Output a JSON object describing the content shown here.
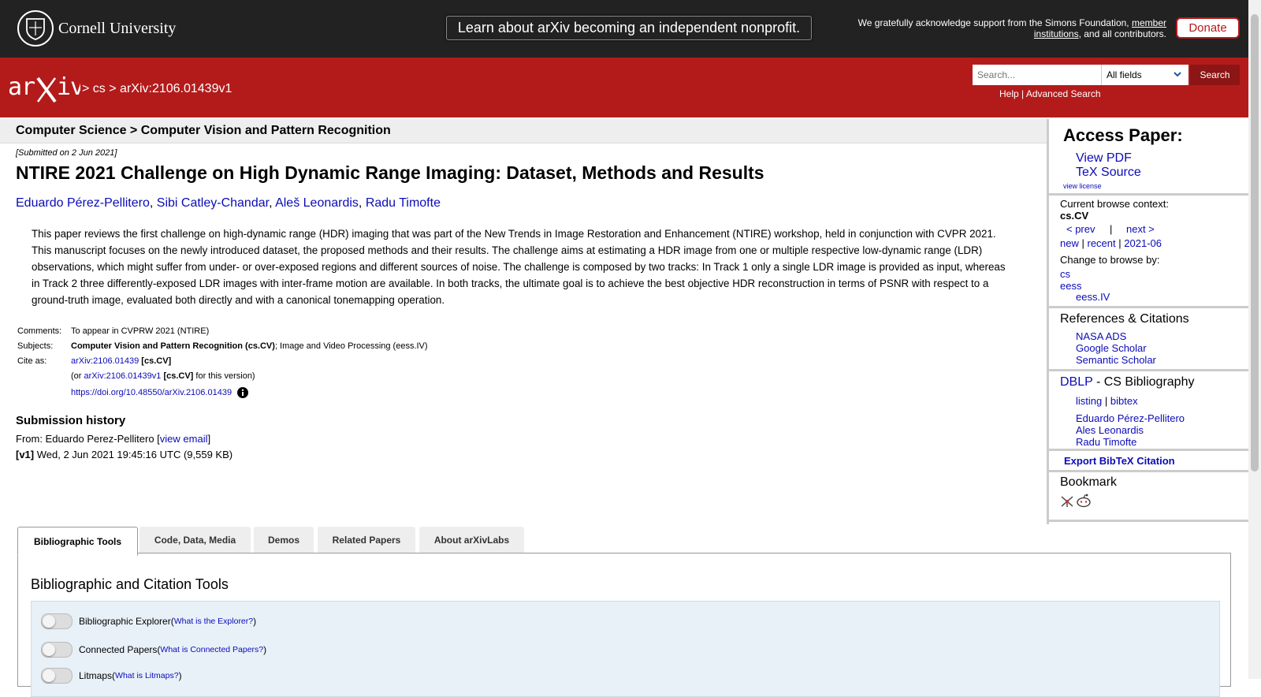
{
  "topbar": {
    "org_name": "Cornell University",
    "announcement": "Learn about arXiv becoming an independent nonprofit.",
    "ack_text": "We gratefully acknowledge support from the Simons Foundation,",
    "ack_link": "member institutions",
    "ack_tail": ", and all contributors.",
    "donate_label": "Donate"
  },
  "header": {
    "breadcrumb_sep1": ">",
    "breadcrumb_cs": "cs",
    "breadcrumb_sep2": ">",
    "breadcrumb_id": "arXiv:2106.01439v1",
    "search_placeholder": "Search...",
    "search_field": "All fields",
    "search_button": "Search",
    "help": "Help",
    "help_sep": "|",
    "advanced": "Advanced Search"
  },
  "subheader": "Computer Science > Computer Vision and Pattern Recognition",
  "paper": {
    "submitted": "[Submitted on 2 Jun 2021]",
    "title": "NTIRE 2021 Challenge on High Dynamic Range Imaging: Dataset, Methods and Results",
    "authors": [
      "Eduardo Pérez-Pellitero",
      "Sibi Catley-Chandar",
      "Aleš Leonardis",
      "Radu Timofte"
    ],
    "abstract": "This paper reviews the first challenge on high-dynamic range (HDR) imaging that was part of the New Trends in Image Restoration and Enhancement (NTIRE) workshop, held in conjunction with CVPR 2021. This manuscript focuses on the newly introduced dataset, the proposed methods and their results. The challenge aims at estimating a HDR image from one or multiple respective low-dynamic range (LDR) observations, which might suffer from under- or over-exposed regions and different sources of noise. The challenge is composed by two tracks: In Track 1 only a single LDR image is provided as input, whereas in Track 2 three differently-exposed LDR images with inter-frame motion are available. In both tracks, the ultimate goal is to achieve the best objective HDR reconstruction in terms of PSNR with respect to a ground-truth image, evaluated both directly and with a canonical tonemapping operation.",
    "comments_label": "Comments:",
    "comments": "To appear in CVPRW 2021 (NTIRE)",
    "subjects_label": "Subjects:",
    "subjects_primary": "Computer Vision and Pattern Recognition (cs.CV)",
    "subjects_secondary": "; Image and Video Processing (eess.IV)",
    "cite_label": "Cite as:",
    "cite_id": "arXiv:2106.01439",
    "cite_cat": "[cs.CV]",
    "cite_or": "(or",
    "cite_version": "arXiv:2106.01439v1",
    "cite_version_cat": "[cs.CV]",
    "cite_version_tail": "for this version)",
    "doi": "https://doi.org/10.48550/arXiv.2106.01439",
    "history_heading": "Submission history",
    "from_prefix": "From: Eduardo Perez-Pellitero [",
    "view_email": "view email",
    "from_suffix": "]",
    "v1_label": "[v1]",
    "v1_text": "Wed, 2 Jun 2021 19:45:16 UTC (9,559 KB)"
  },
  "sidebar": {
    "access_heading": "Access Paper:",
    "view_pdf": "View PDF",
    "tex_source": "TeX Source",
    "view_license": "view license",
    "browse_context_label": "Current browse context:",
    "browse_context": "cs.CV",
    "prev": "< prev",
    "sep": "|",
    "next": "next >",
    "new": "new",
    "recent": "recent",
    "month": "2021-06",
    "change_browse": "Change to browse by:",
    "browse_cs": "cs",
    "browse_eess": "eess",
    "browse_eessiv": "eess.IV",
    "refs_heading": "References & Citations",
    "nasa": "NASA ADS",
    "google": "Google Scholar",
    "semantic": "Semantic Scholar",
    "dblp": "DBLP",
    "dblp_tail": " - CS Bibliography",
    "listing": "listing",
    "bibtex": "bibtex",
    "dblp_authors": [
      "Eduardo Pérez-Pellitero",
      "Ales Leonardis",
      "Radu Timofte"
    ],
    "export_bibtex": "Export BibTeX Citation",
    "bookmark": "Bookmark"
  },
  "tabs": [
    "Bibliographic Tools",
    "Code, Data, Media",
    "Demos",
    "Related Papers",
    "About arXivLabs"
  ],
  "panel": {
    "title": "Bibliographic and Citation Tools",
    "toggles": [
      {
        "label": "Bibliographic Explorer",
        "open": " (",
        "link": "What is the Explorer?",
        "close": ")"
      },
      {
        "label": "Connected Papers",
        "open": " (",
        "link": "What is Connected Papers?",
        "close": ")"
      },
      {
        "label": "Litmaps",
        "open": " (",
        "link": "What is Litmaps?",
        "close": ")"
      }
    ]
  },
  "colors": {
    "brand_red": "#b31b1b",
    "dark_bar": "#222222",
    "link": "#0b0bb8"
  }
}
